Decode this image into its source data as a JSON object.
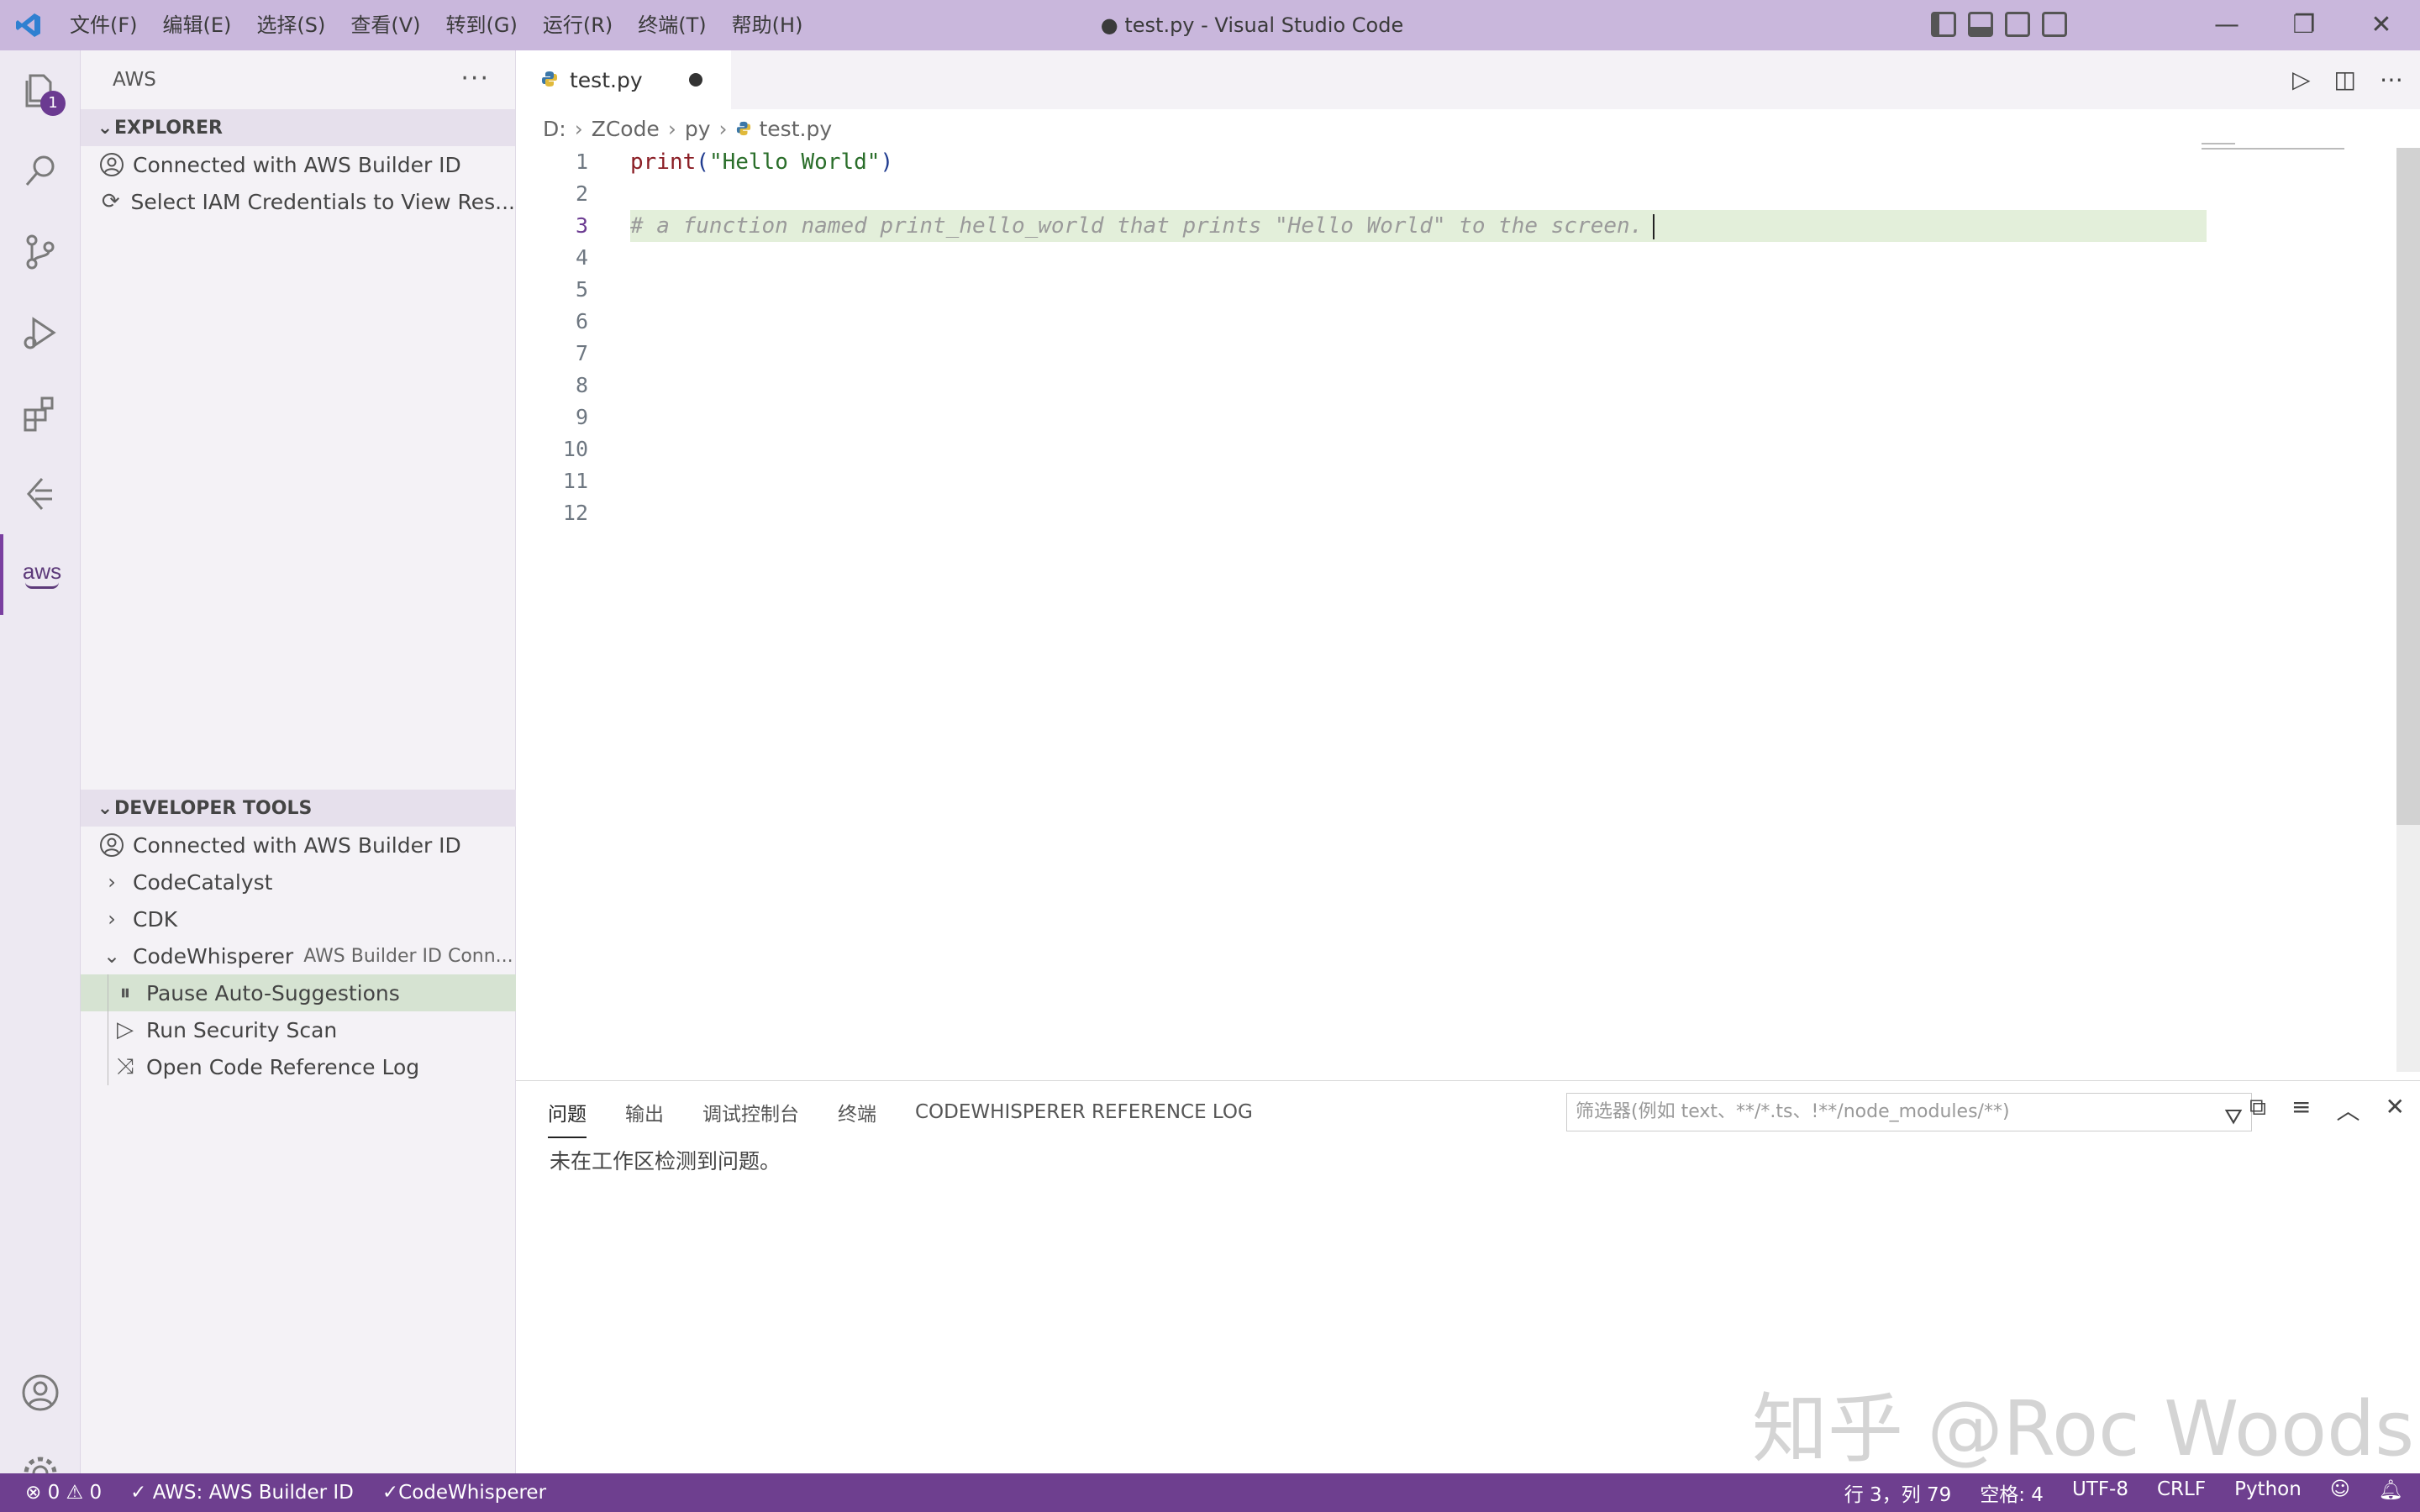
{
  "title_bar": {
    "menu": [
      "文件(F)",
      "编辑(E)",
      "选择(S)",
      "查看(V)",
      "转到(G)",
      "运行(R)",
      "终端(T)",
      "帮助(H)"
    ],
    "window_title": "● test.py - Visual Studio Code",
    "window_controls": [
      "minimize",
      "restore",
      "close"
    ]
  },
  "activity_bar": {
    "explorer_badge": "1",
    "items": [
      "explorer-icon",
      "search-icon",
      "source-control-icon",
      "run-debug-icon",
      "extensions-icon",
      "remote-icon",
      "aws-icon"
    ],
    "bottom": [
      "account-icon",
      "gear-icon"
    ],
    "aws_label": "aws"
  },
  "sidebar": {
    "header": "AWS",
    "more": "···",
    "explorer": {
      "title": "EXPLORER",
      "rows": [
        {
          "icon": "account-icon",
          "label": "Connected with AWS Builder ID"
        },
        {
          "icon": "refresh-icon",
          "label": "Select IAM Credentials to View Res..."
        }
      ]
    },
    "developer_tools": {
      "title": "DEVELOPER TOOLS",
      "rows": [
        {
          "label": "Connected with AWS Builder ID"
        },
        {
          "label": "CodeCatalyst"
        },
        {
          "label": "CDK"
        },
        {
          "label": "CodeWhisperer",
          "desc": "AWS Builder ID Conn..."
        },
        {
          "label": "Pause Auto-Suggestions"
        },
        {
          "label": "Run Security Scan"
        },
        {
          "label": "Open Code Reference Log"
        }
      ]
    }
  },
  "tabs": [
    {
      "label": "test.py",
      "modified": true
    }
  ],
  "breadcrumb": [
    "D:",
    "ZCode",
    "py",
    "test.py"
  ],
  "editor": {
    "line_numbers": [
      "1",
      "2",
      "3",
      "4",
      "5",
      "6",
      "7",
      "8",
      "9",
      "10",
      "11",
      "12"
    ],
    "line1": {
      "fn": "print",
      "open": "(",
      "str": "\"Hello World\"",
      "close": ")"
    },
    "line3_ghost": "# a function named print_hello_world that prints \"Hello World\" to the screen."
  },
  "panel": {
    "tabs": [
      "问题",
      "输出",
      "调试控制台",
      "终端",
      "CODEWHISPERER REFERENCE LOG"
    ],
    "filter_placeholder": "筛选器(例如 text、**/*.ts、!**/node_modules/**)",
    "message": "未在工作区检测到问题。"
  },
  "status_bar": {
    "errors": "0",
    "warnings": "0",
    "aws": "AWS: AWS Builder ID",
    "codewhisperer": "CodeWhisperer",
    "position": "行 3，列 79",
    "spaces": "空格: 4",
    "encoding": "UTF-8",
    "eol": "CRLF",
    "language": "Python"
  },
  "watermark": "知乎 @Roc Woods",
  "colors": {
    "title_bar": "#c9b7dc",
    "status_bar": "#6e3f8f",
    "badge": "#6b3a91",
    "selection": "#d6e3d2",
    "line_highlight": "#e3efda"
  }
}
